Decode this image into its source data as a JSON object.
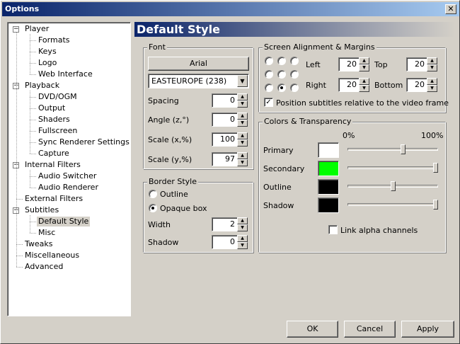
{
  "window": {
    "title": "Options",
    "close_glyph": "✕"
  },
  "tree": [
    {
      "label": "Player",
      "expander": "−"
    },
    {
      "label": "Formats"
    },
    {
      "label": "Keys"
    },
    {
      "label": "Logo"
    },
    {
      "label": "Web Interface"
    },
    {
      "label": "Playback",
      "expander": "−"
    },
    {
      "label": "DVD/OGM"
    },
    {
      "label": "Output"
    },
    {
      "label": "Shaders"
    },
    {
      "label": "Fullscreen"
    },
    {
      "label": "Sync Renderer Settings"
    },
    {
      "label": "Capture"
    },
    {
      "label": "Internal Filters",
      "expander": "−"
    },
    {
      "label": "Audio Switcher"
    },
    {
      "label": "Audio Renderer"
    },
    {
      "label": "External Filters"
    },
    {
      "label": "Subtitles",
      "expander": "−"
    },
    {
      "label": "Default Style",
      "selected": true
    },
    {
      "label": "Misc"
    },
    {
      "label": "Tweaks"
    },
    {
      "label": "Miscellaneous"
    },
    {
      "label": "Advanced"
    }
  ],
  "page_title": "Default Style",
  "font": {
    "group": "Font",
    "font_button": "Arial",
    "charset": "EASTEUROPE (238)",
    "spacing_label": "Spacing",
    "spacing": "0",
    "angle_label": "Angle (z,°)",
    "angle": "0",
    "scalex_label": "Scale (x,%)",
    "scalex": "100",
    "scaley_label": "Scale (y,%)",
    "scaley": "97"
  },
  "border": {
    "group": "Border Style",
    "outline_label": "Outline",
    "opaque_label": "Opaque box",
    "width_label": "Width",
    "width": "2",
    "shadow_label": "Shadow",
    "shadow": "0"
  },
  "alignment": {
    "group": "Screen Alignment & Margins",
    "left_label": "Left",
    "left": "20",
    "top_label": "Top",
    "top": "20",
    "right_label": "Right",
    "right": "20",
    "bottom_label": "Bottom",
    "bottom": "20",
    "position_label": "Position subtitles relative to the video frame",
    "position_checked": true,
    "selected_cell": 7
  },
  "colors": {
    "group": "Colors & Transparency",
    "pct0": "0%",
    "pct100": "100%",
    "rows": [
      {
        "label": "Primary",
        "color": "#ffffff",
        "alpha": 0.62
      },
      {
        "label": "Secondary",
        "color": "#00ff00",
        "alpha": 1.0
      },
      {
        "label": "Outline",
        "color": "#000000",
        "alpha": 0.5
      },
      {
        "label": "Shadow",
        "color": "#000000",
        "alpha": 1.0
      }
    ],
    "link_label": "Link alpha channels",
    "link_checked": false
  },
  "buttons": {
    "ok": "OK",
    "cancel": "Cancel",
    "apply": "Apply"
  }
}
